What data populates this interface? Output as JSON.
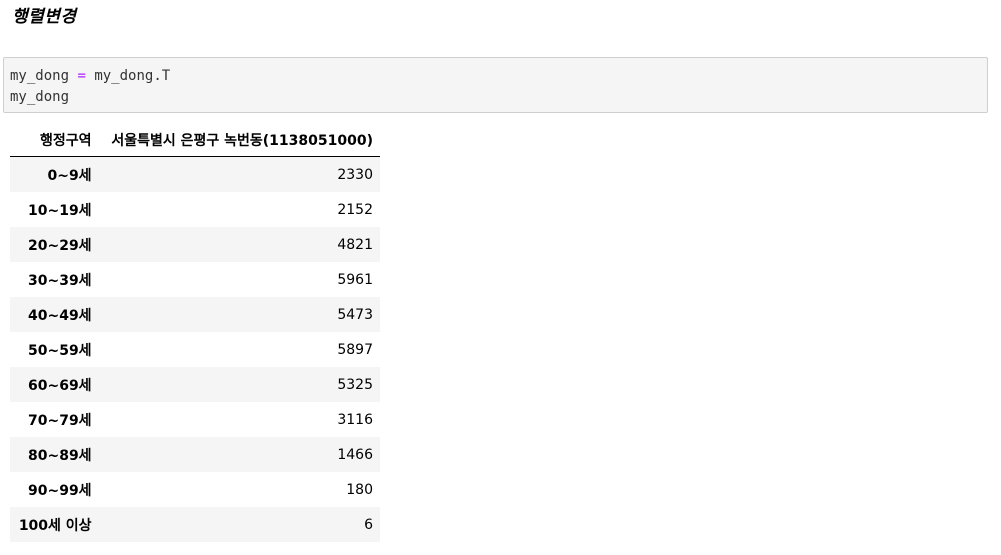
{
  "heading": "행렬변경",
  "code": {
    "line1_var": "my_dong",
    "line1_op": "=",
    "line1_expr": "my_dong.T",
    "line2": "my_dong"
  },
  "table": {
    "index_name": "행정구역",
    "column": "서울특별시 은평구 녹번동(1138051000)",
    "rows": [
      {
        "label": "0~9세",
        "value": "2330"
      },
      {
        "label": "10~19세",
        "value": "2152"
      },
      {
        "label": "20~29세",
        "value": "4821"
      },
      {
        "label": "30~39세",
        "value": "5961"
      },
      {
        "label": "40~49세",
        "value": "5473"
      },
      {
        "label": "50~59세",
        "value": "5897"
      },
      {
        "label": "60~69세",
        "value": "5325"
      },
      {
        "label": "70~79세",
        "value": "3116"
      },
      {
        "label": "80~89세",
        "value": "1466"
      },
      {
        "label": "90~99세",
        "value": "180"
      },
      {
        "label": "100세 이상",
        "value": "6"
      }
    ]
  }
}
